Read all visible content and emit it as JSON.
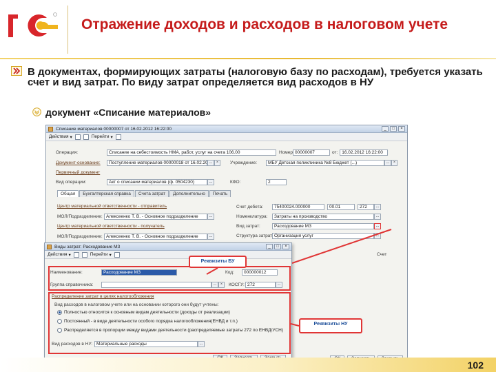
{
  "slide": {
    "title": "Отражение доходов и расходов в налоговом учете",
    "main_text": "В документах, формирующих затраты (налоговую базу по расходам), требуется указать счет и вид затрат. По виду затрат определяется вид расходов в НУ",
    "sub_text": "документ «Списание материалов»",
    "page_number": "102"
  },
  "doc_window": {
    "title": "Списание материалов 00000007 от 16.02.2012 16:22:00",
    "toolbar": [
      "Действия",
      "Перейти"
    ],
    "fields": {
      "operation_label": "Операция:",
      "operation_value": "Списание на себестоимость НМА, работ, услуг на счета 106.00",
      "number_label": "Номер:",
      "number_value": "00000007",
      "date_label": "от:",
      "date_value": "16.02.2012 16:22:00",
      "basis_label": "Документ-основание:",
      "basis_value": "Поступление материалов 00000018 от 16.02.2012",
      "institution_label": "Учреждение:",
      "institution_value": "МБУ Детская поликлиника №8 Бюджет (...)",
      "primary_label": "Первичный документ",
      "purpose_label": "Вид операции:",
      "purpose_value": "Акт о списании материалов (ф. 0504230)",
      "kfo_label": "КФО:",
      "kfo_value": "2"
    },
    "tabs": [
      "Общая",
      "Бухгалтерская справка",
      "Счета затрат",
      "Дополнительно",
      "Печать"
    ],
    "sections": {
      "sender_title": "Центр материальной ответственности - отправитель",
      "mol_sender_label": "МОЛ/Подразделение:",
      "mol_sender_value": "Алексеенко Т. В. - Основное подразделение",
      "receiver_title": "Центр материальной ответственности - получатель",
      "mol_receiver_label": "МОЛ/Подразделение:",
      "mol_receiver_value": "Алексеенко Т. В. - Основное подразделение",
      "debit_label": "Счет дебета:",
      "debit_value": "75400024.000000",
      "debit_kosgu": "00.01",
      "debit_code": "272",
      "nomenclature_label": "Номенклатура:",
      "nomenclature_value": "Затраты на производство",
      "cost_type_label": "Вид затрат:",
      "cost_type_value": "Расходование МЗ",
      "structural_label": "Структура затрат:",
      "structural_value": "Организация услуг",
      "right_account_label": "Счет"
    }
  },
  "ref_window": {
    "title": "Виды затрат: Расходование МЗ",
    "toolbar": [
      "Действия",
      "Перейти"
    ],
    "name_label": "Наименование:",
    "name_value": "Расходование МЗ",
    "code_label": "Код:",
    "code_value": "000000012",
    "group_label": "Группа справочника:",
    "kosgu_label": "КОСГУ:",
    "kosgu_value": "272",
    "section_title": "Распределение затрат в целях налогообложения",
    "method_label": "Вид расходов в налоговом учете или на основании которого они будут учтены:",
    "radios": [
      "Полностью относится к основным видам деятельности (доходы от реализации)",
      "Постоянный - в виде деятельности особого порядка налогообложения(ЕНВД и т.п.)",
      "Распределяется в пропорции между видами деятельности (распределяемые затраты 272 по ЕНВД/УСН)"
    ],
    "expense_type_label": "Вид расходов в НУ:",
    "expense_type_value": "Материальные расходы",
    "buttons": [
      "ОК",
      "Записать",
      "Закрыть"
    ]
  },
  "doc_status_buttons": [
    "ОК",
    "Записать",
    "Закрыть"
  ],
  "callouts": {
    "top": "Реквизиты БУ",
    "bottom": "Реквизиты НУ"
  },
  "colors": {
    "title": "#c51b1b",
    "highlight": "#e03535",
    "callout_text": "#1d4f9a"
  }
}
